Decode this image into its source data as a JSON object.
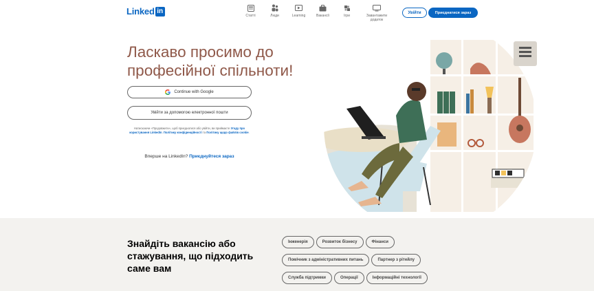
{
  "header": {
    "logo_text": "Linked",
    "logo_box": "in",
    "nav": [
      {
        "label": "Статті",
        "icon": "articles-icon"
      },
      {
        "label": "Люди",
        "icon": "people-icon"
      },
      {
        "label": "Learning",
        "icon": "learning-icon"
      },
      {
        "label": "Вакансії",
        "icon": "jobs-icon"
      },
      {
        "label": "Ігри",
        "icon": "games-icon"
      },
      {
        "label": "Завантажити додаток",
        "icon": "download-app-icon"
      }
    ],
    "login_label": "Увійти",
    "join_label": "Приєднатися зараз"
  },
  "hero": {
    "title": "Ласкаво просимо до професійної спільноти!",
    "google_button": "Continue with Google",
    "email_button": "Увійти за допомогою електронної пошти",
    "legal_prefix": "Натискаючи «Продовжити», щоб приєднатися або увійти, ви приймаєте",
    "legal_link_agreement": "Угоду про користування LinkedIn",
    "legal_link_privacy": "Політику конфіденційності",
    "legal_and": "та",
    "legal_link_cookies": "Політику щодо файлів cookie",
    "new_text": "Вперше на LinkedIn?",
    "new_link": "Приєднуйтеся зараз"
  },
  "jobs_section": {
    "title": "Знайдіть вакансію або стажування, що підходить саме вам",
    "pills": [
      [
        "Інженерія",
        "Розвиток бізнесу",
        "Фінанси"
      ],
      [
        "Помічник з адміністративних питань",
        "Партнер з рітейлу"
      ],
      [
        "Служба підтримки",
        "Операції",
        "Інформаційні технології"
      ]
    ]
  },
  "colors": {
    "brand": "#0a66c2",
    "hero_title": "#8f5849",
    "bottom_bg": "#f3f2ef"
  }
}
